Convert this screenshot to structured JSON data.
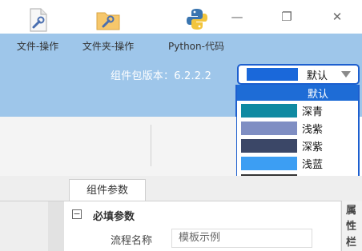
{
  "window": {
    "minimize_glyph": "—",
    "restore_glyph": "❐",
    "close_glyph": "✕"
  },
  "header": {
    "version_text": "组件包版本：6.2.2.2"
  },
  "theme_select": {
    "value": "默认",
    "options": [
      {
        "label": "默认",
        "color": "#1e6cd6"
      },
      {
        "label": "深青",
        "color": "#0f8aa2"
      },
      {
        "label": "浅紫",
        "color": "#7f8ec3"
      },
      {
        "label": "深紫",
        "color": "#3b4767"
      },
      {
        "label": "浅蓝",
        "color": "#3c9ef3"
      },
      {
        "label": "暗黑",
        "color": "#343434"
      }
    ]
  },
  "toolbar": {
    "items": [
      {
        "label": "文件-操作",
        "icon": "file-wrench-icon"
      },
      {
        "label": "文件夹-操作",
        "icon": "folder-wrench-icon"
      },
      {
        "label": "Python-代码",
        "icon": "python-icon"
      }
    ]
  },
  "tabs": [
    {
      "label": "组件参数"
    }
  ],
  "section": {
    "title": "必填参数",
    "collapse_glyph": "−"
  },
  "fields": [
    {
      "label": "流程名称",
      "value": "模板示例"
    }
  ],
  "side_panel": {
    "label_chars": [
      "属",
      "性",
      "栏"
    ]
  }
}
